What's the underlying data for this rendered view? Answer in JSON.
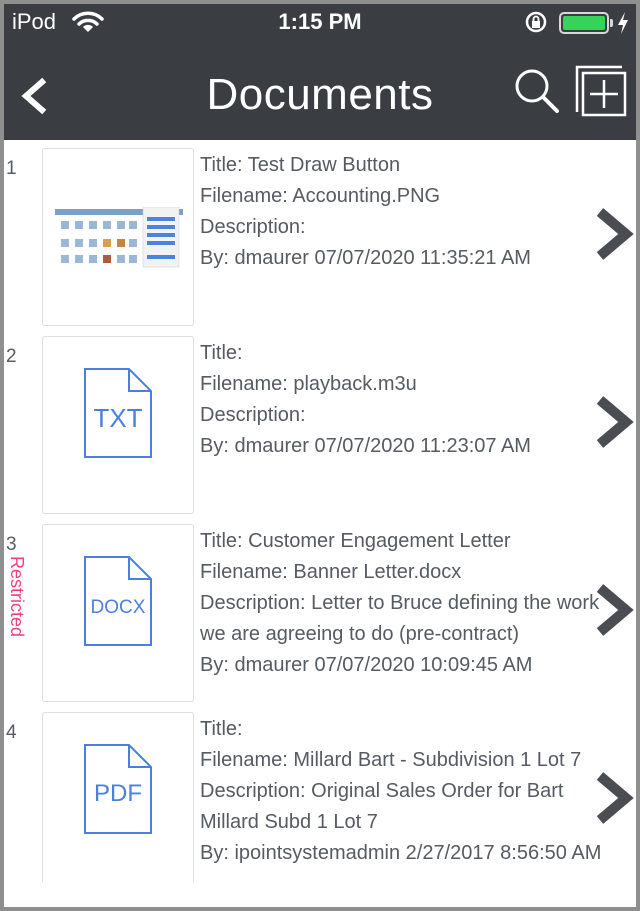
{
  "status_bar": {
    "carrier": "iPod",
    "time": "1:15 PM"
  },
  "nav": {
    "title": "Documents",
    "back_icon": "chevron-left-icon",
    "search_icon": "search-icon",
    "add_icon": "add-document-icon"
  },
  "colors": {
    "bar_bg": "#3a3d42",
    "text": "#555b63",
    "file_icon_blue": "#4a7fe0",
    "restricted_pink": "#ee3f7f",
    "battery_green": "#35d35a"
  },
  "documents": [
    {
      "index": "1",
      "title": "Title: Test Draw Button",
      "filename": "Filename: Accounting.PNG",
      "description": "Description:",
      "by": "By: dmaurer 07/07/2020 11:35:21 AM",
      "thumbnail": "image-preview"
    },
    {
      "index": "2",
      "title": "Title:",
      "filename": "Filename: playback.m3u",
      "description": "Description:",
      "by": "By: dmaurer 07/07/2020 11:23:07 AM",
      "file_type": "TXT"
    },
    {
      "index": "3",
      "restricted": "Restricted",
      "title": "Title: Customer Engagement Letter",
      "filename": "Filename: Banner Letter.docx",
      "description": "Description: Letter to Bruce defining the work we are agreeing to do (pre-contract)",
      "by": "By: dmaurer 07/07/2020 10:09:45 AM",
      "file_type": "DOCX"
    },
    {
      "index": "4",
      "title": "Title:",
      "filename": "Filename: Millard Bart - Subdivision 1 Lot 7",
      "description": "Description: Original Sales Order for Bart Millard Subd 1 Lot 7",
      "by": "By: ipointsystemadmin 2/27/2017 8:56:50 AM",
      "file_type": "PDF"
    }
  ]
}
